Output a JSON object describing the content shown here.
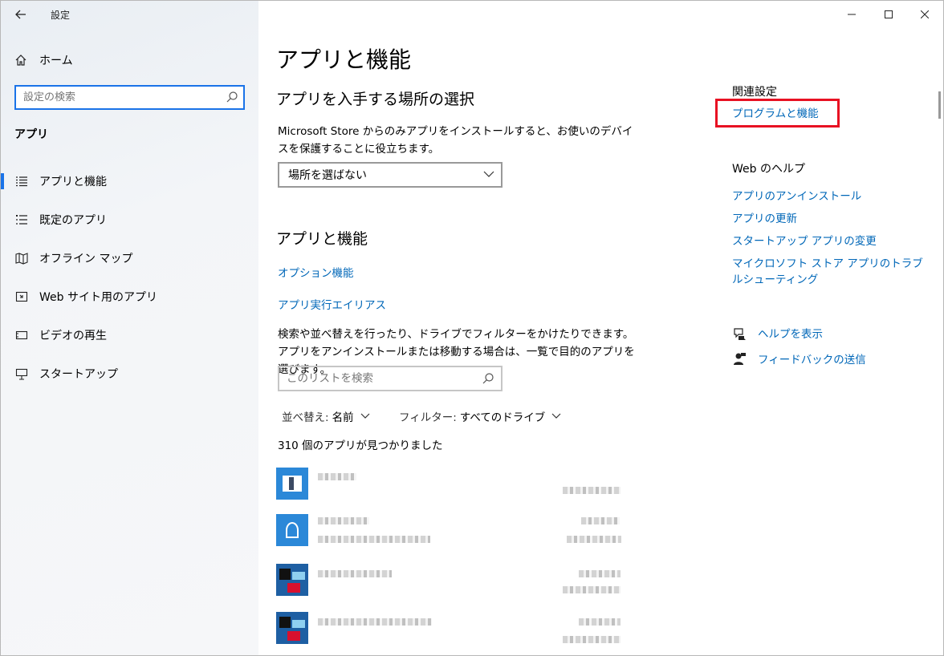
{
  "window": {
    "title": "設定"
  },
  "sidebar": {
    "home_label": "ホーム",
    "search_placeholder": "設定の検索",
    "section_title": "アプリ",
    "items": [
      {
        "label": "アプリと機能",
        "icon": "list-icon",
        "active": true
      },
      {
        "label": "既定のアプリ",
        "icon": "default-apps-icon"
      },
      {
        "label": "オフライン マップ",
        "icon": "map-icon"
      },
      {
        "label": "Web サイト用のアプリ",
        "icon": "web-app-icon"
      },
      {
        "label": "ビデオの再生",
        "icon": "video-icon"
      },
      {
        "label": "スタートアップ",
        "icon": "startup-icon"
      }
    ]
  },
  "main": {
    "page_title": "アプリと機能",
    "install_section": {
      "heading": "アプリを入手する場所の選択",
      "description": "Microsoft Store からのみアプリをインストールすると、お使いのデバイスを保護することに役立ちます。",
      "dropdown_value": "場所を選ばない"
    },
    "apps_section": {
      "heading": "アプリと機能",
      "optional_features_link": "オプション機能",
      "app_alias_link": "アプリ実行エイリアス",
      "description": "検索や並べ替えを行ったり、ドライブでフィルターをかけたりできます。アプリをアンインストールまたは移動する場合は、一覧で目的のアプリを選びます。",
      "search_placeholder": "このリストを検索",
      "sort_label": "並べ替え:",
      "sort_value": "名前",
      "filter_label": "フィルター:",
      "filter_value": "すべてのドライブ",
      "count_text": "310 個のアプリが見つかりました"
    }
  },
  "right": {
    "related_title": "関連設定",
    "programs_link": "プログラムと機能",
    "help_title": "Web のヘルプ",
    "help_links": [
      "アプリのアンインストール",
      "アプリの更新",
      "スタートアップ アプリの変更",
      "マイクロソフト ストア アプリのトラブルシューティング"
    ],
    "show_help": "ヘルプを表示",
    "send_feedback": "フィードバックの送信"
  },
  "colors": {
    "accent": "#0067b8",
    "highlight": "#e81123",
    "app_tile": "#2b88d8"
  }
}
